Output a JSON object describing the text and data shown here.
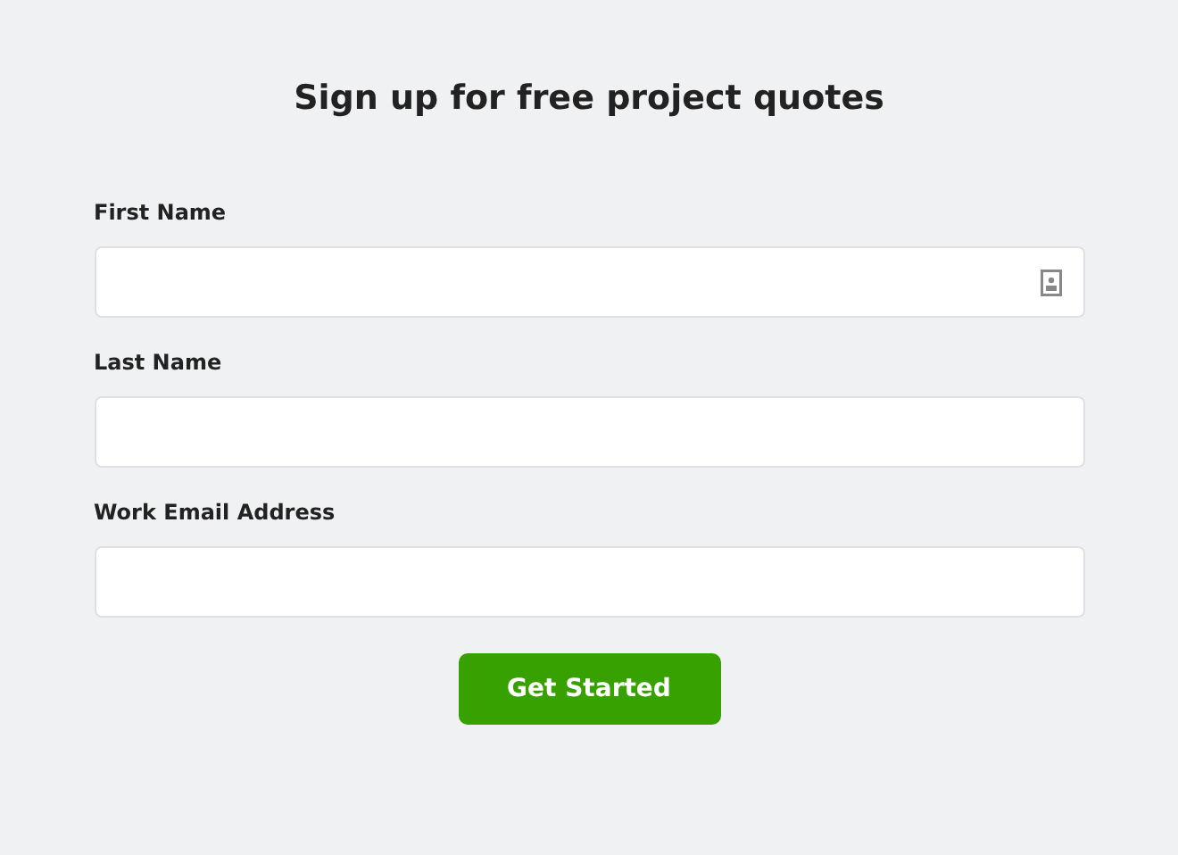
{
  "title": "Sign up for free project quotes",
  "fields": [
    {
      "label": "First Name",
      "autofill_icon": true
    },
    {
      "label": "Last Name",
      "autofill_icon": false
    },
    {
      "label": "Work Email Address",
      "autofill_icon": false
    }
  ],
  "submit": {
    "label": "Get Started"
  }
}
